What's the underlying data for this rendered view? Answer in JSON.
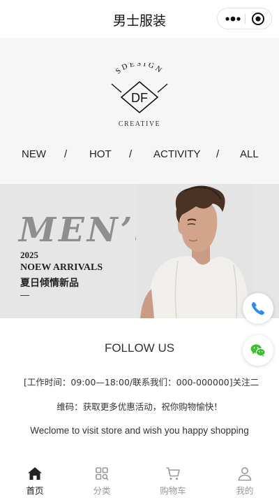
{
  "header": {
    "title": "男士服装"
  },
  "logo": {
    "arc_text": "SDESIGN",
    "monogram": "DF",
    "tagline": "CREATIVE"
  },
  "menu": {
    "items": [
      "NEW",
      "HOT",
      "ACTIVITY",
      "ALL"
    ],
    "separator": "/"
  },
  "banner": {
    "headline": "MEN’S",
    "year": "2025",
    "subtitle": "NOEW ARRIVALS",
    "cn_subtitle": "夏日倾情新品"
  },
  "floating": {
    "phone_icon": "phone-icon",
    "wechat_icon": "wechat-icon"
  },
  "footer": {
    "heading": "FOLLOW US",
    "line1": "[工作时间：09:00—18:00/联系我们：000-000000]关注二",
    "line2": "维码：获取更多优惠活动，祝你购物愉快！",
    "line3": "Weclome to visit store and wish you happy shopping"
  },
  "tabbar": {
    "tabs": [
      {
        "label": "首页",
        "icon": "home-icon",
        "active": true
      },
      {
        "label": "分类",
        "icon": "category-icon",
        "active": false
      },
      {
        "label": "购物车",
        "icon": "cart-icon",
        "active": false
      },
      {
        "label": "我的",
        "icon": "user-icon",
        "active": false
      }
    ]
  },
  "colors": {
    "brand_bg": "#f6f6f6",
    "banner_bg": "#e6e6e6",
    "phone_blue": "#2a8cf0",
    "wechat_green": "#3bbf2f",
    "active_tab": "#222222",
    "inactive_tab": "#999999"
  }
}
